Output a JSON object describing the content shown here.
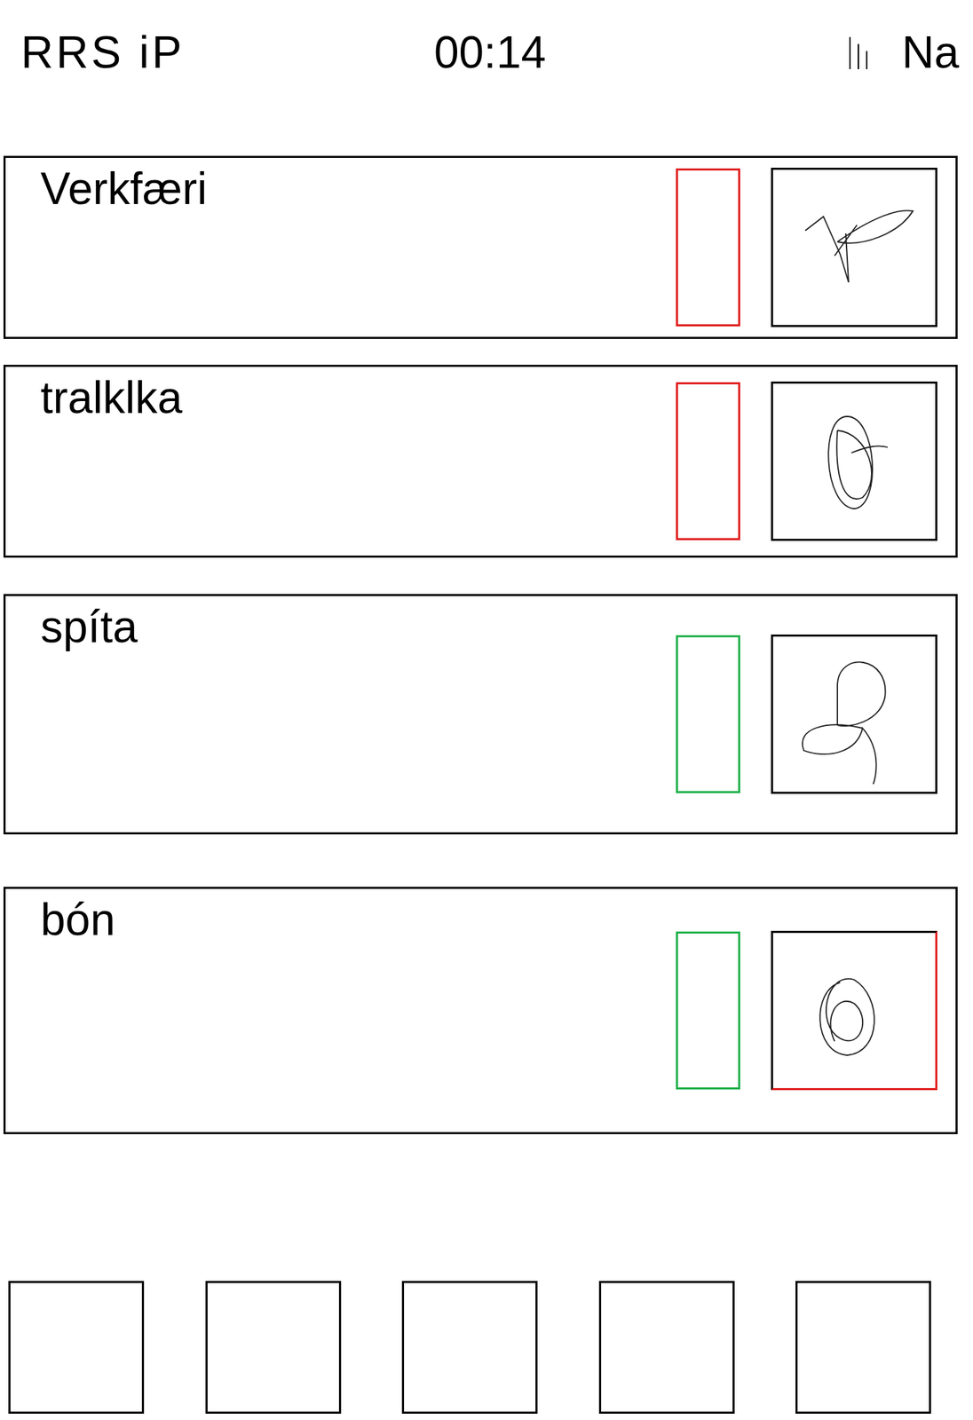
{
  "status_bar": {
    "carrier": "RRS iP",
    "time": "00:14",
    "network": "Na"
  },
  "cards": [
    {
      "title": "Verkfæri",
      "status_color": "#e02020",
      "frame_color": "#000000"
    },
    {
      "title": "tralklka",
      "status_color": "#e02020",
      "frame_color": "#000000"
    },
    {
      "title": "spíta",
      "status_color": "#22b14c",
      "frame_color": "#000000"
    },
    {
      "title": "bón",
      "status_color": "#22b14c",
      "frame_color": "#e02020"
    }
  ],
  "slots": [
    {
      "empty": true
    },
    {
      "empty": true
    },
    {
      "empty": true
    },
    {
      "empty": true
    },
    {
      "empty": true
    }
  ]
}
